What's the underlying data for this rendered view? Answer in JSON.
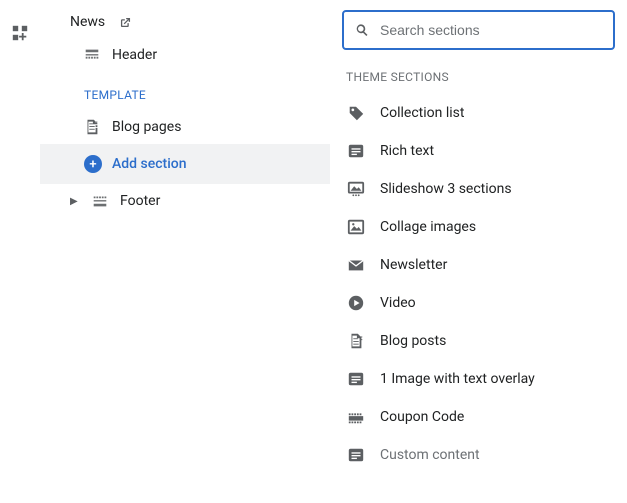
{
  "rail": {
    "apps_icon": "apps"
  },
  "sidebar": {
    "top_item": {
      "label": "News"
    },
    "header_item": {
      "label": "Header"
    },
    "template_group_label": "TEMPLATE",
    "template_items": [
      {
        "label": "Blog pages"
      }
    ],
    "add_section_label": "Add section",
    "footer_item": {
      "label": "Footer"
    }
  },
  "panel": {
    "search_placeholder": "Search sections",
    "group_label": "THEME SECTIONS",
    "items": [
      {
        "icon": "tag",
        "label": "Collection list"
      },
      {
        "icon": "richtext",
        "label": "Rich text"
      },
      {
        "icon": "slideshow",
        "label": "Slideshow 3 sections"
      },
      {
        "icon": "collage",
        "label": "Collage images"
      },
      {
        "icon": "mail",
        "label": "Newsletter"
      },
      {
        "icon": "video",
        "label": "Video"
      },
      {
        "icon": "blog",
        "label": "Blog posts"
      },
      {
        "icon": "richtext",
        "label": "1 Image with text overlay"
      },
      {
        "icon": "coupon",
        "label": "Coupon Code"
      },
      {
        "icon": "richtext",
        "label": "Custom content"
      }
    ]
  }
}
